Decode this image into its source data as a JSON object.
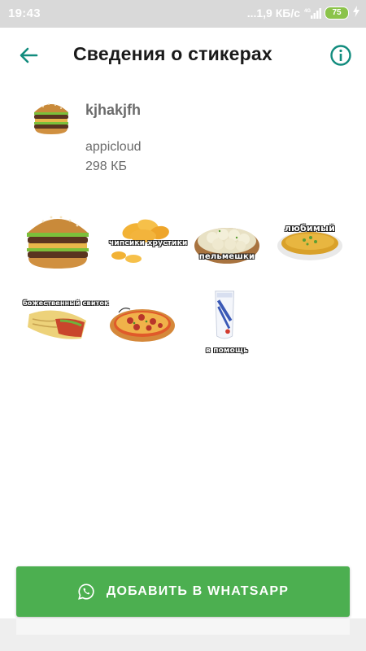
{
  "status_bar": {
    "time": "19:43",
    "network_speed": "...1,9 КБ/с",
    "network_type": "4G",
    "battery_level": "75"
  },
  "app_bar": {
    "title": "Сведения о стикерах",
    "back_icon": "arrow-left-icon",
    "info_icon": "info-icon"
  },
  "pack": {
    "name": "kjhakjfh",
    "publisher": "appicloud",
    "size": "298 КБ",
    "thumbnail_icon": "burger-icon"
  },
  "stickers": [
    {
      "name": "burger",
      "caption": ""
    },
    {
      "name": "chips",
      "caption": "чипсики хрустики"
    },
    {
      "name": "dumplings",
      "caption": "пельмешки"
    },
    {
      "name": "soup",
      "caption": "любимый"
    },
    {
      "name": "shawarma",
      "caption": "божественный свиток"
    },
    {
      "name": "pizza",
      "caption": ""
    },
    {
      "name": "condensed-milk",
      "caption": "в помощь"
    }
  ],
  "add_button": {
    "label": "ДОБАВИТЬ В WHATSAPP",
    "icon": "whatsapp-icon"
  },
  "colors": {
    "accent": "#128c7e",
    "button_green": "#4caf50",
    "status_bar_bg": "#d9d9d9",
    "text_secondary": "#6b6b6b"
  }
}
